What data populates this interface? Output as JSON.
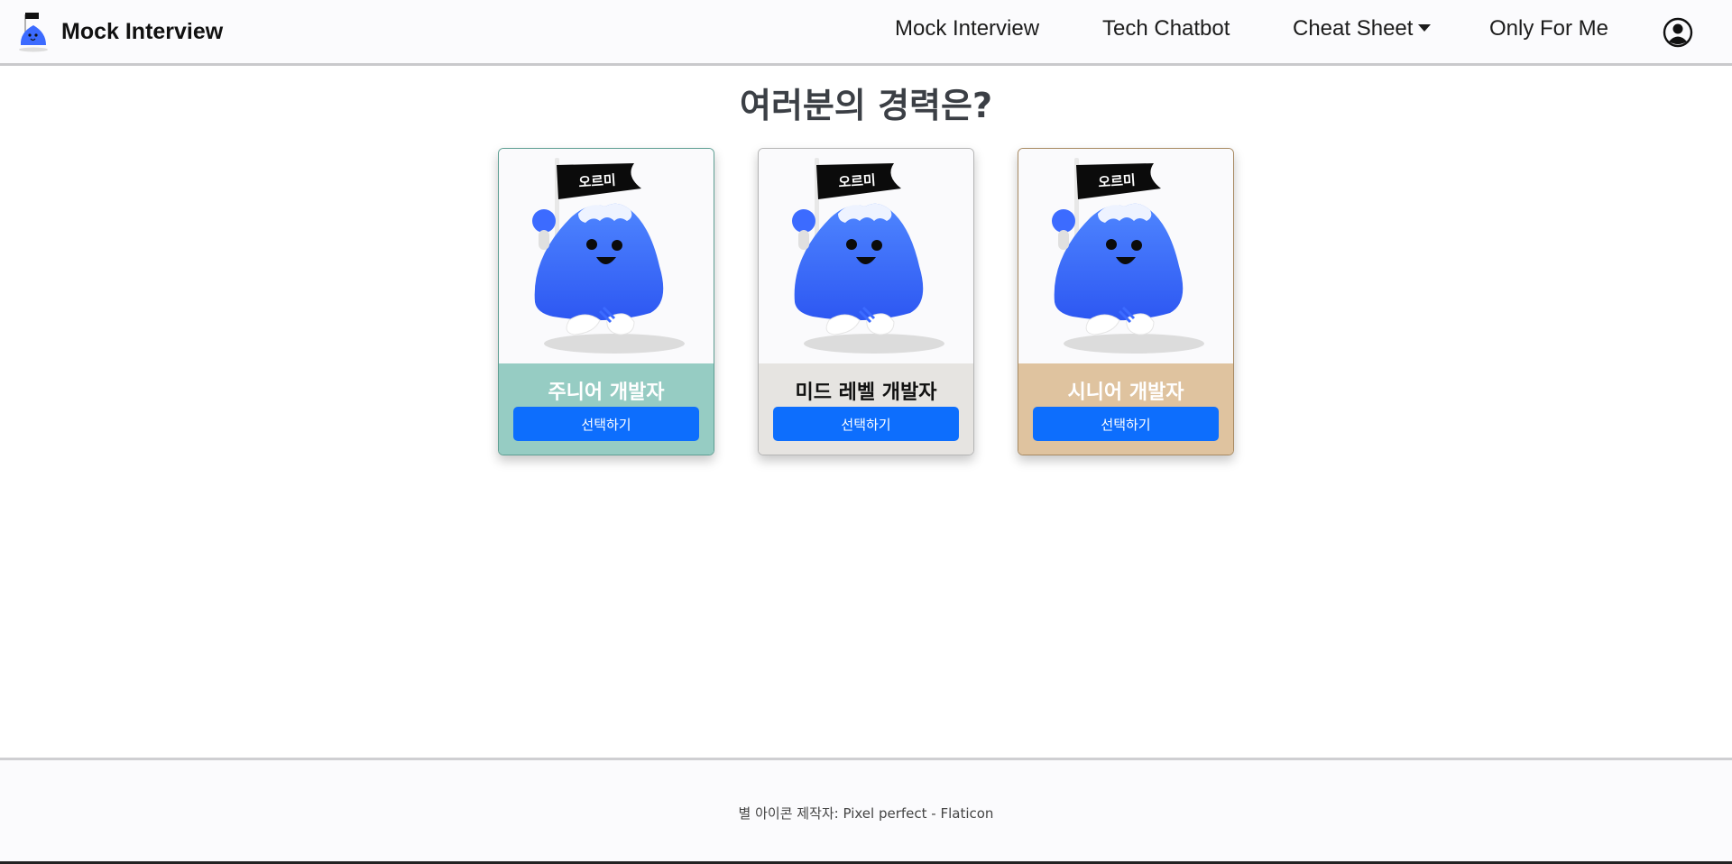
{
  "navbar": {
    "brand": "Mock Interview",
    "items": [
      {
        "label": "Mock Interview"
      },
      {
        "label": "Tech Chatbot"
      },
      {
        "label": "Cheat Sheet"
      },
      {
        "label": "Only For Me"
      }
    ],
    "user_icon": "user-circle-icon"
  },
  "main": {
    "title": "여러분의 경력은?",
    "flag_text": "오르미",
    "cards": [
      {
        "title": "주니어 개발자",
        "button": "선택하기",
        "color": "#96ccc3"
      },
      {
        "title": "미드 레벨 개발자",
        "button": "선택하기",
        "color": "#e6e4e1"
      },
      {
        "title": "시니어 개발자",
        "button": "선택하기",
        "color": "#dfc39f"
      }
    ]
  },
  "footer": {
    "credit": "별 아이콘 제작자: Pixel perfect - Flaticon"
  },
  "colors": {
    "primary_button": "#0d6efd",
    "mascot_blue": "#3c6bff"
  }
}
